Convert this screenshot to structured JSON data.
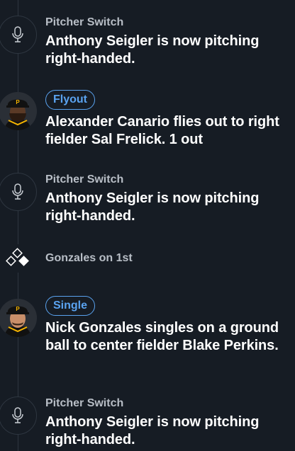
{
  "events": [
    {
      "type": "pitcher-switch",
      "label": "Pitcher Switch",
      "text": "Anthony Seigler is now pitching right-handed."
    },
    {
      "type": "play",
      "badge": "Flyout",
      "text": "Alexander Canario flies out to right fielder Sal Frelick. ",
      "outs": "1 out",
      "team_logo": "P"
    },
    {
      "type": "pitcher-switch",
      "label": "Pitcher Switch",
      "text": "Anthony Seigler is now pitching right-handed."
    },
    {
      "type": "runner",
      "label": "Gonzales on 1st"
    },
    {
      "type": "play",
      "badge": "Single",
      "text": "Nick Gonzales singles on a ground ball to center fielder Blake Perkins.",
      "team_logo": "P"
    },
    {
      "type": "pitcher-switch",
      "label": "Pitcher Switch",
      "text": "Anthony Seigler is now pitching right-handed."
    }
  ],
  "colors": {
    "background": "#161c24",
    "badge": "#5aa3f0",
    "label": "#b8bec6",
    "cap_black": "#111111",
    "cap_gold": "#f7b500"
  },
  "icons": {
    "pitcher_switch": "microphone-icon",
    "runner": "bases-diamond-icon"
  }
}
